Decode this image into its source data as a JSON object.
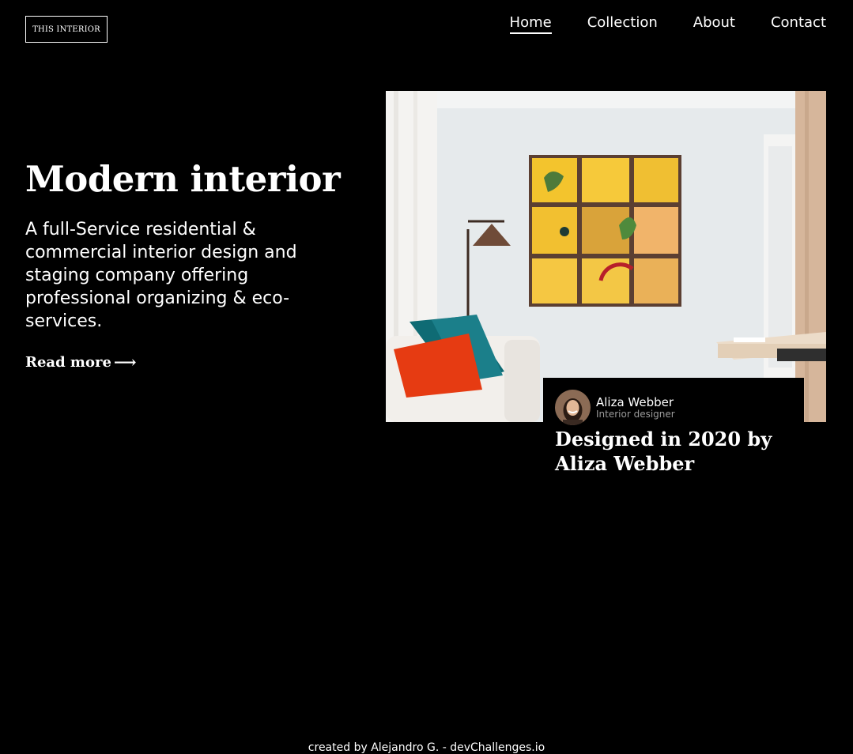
{
  "logo": {
    "text": "THIS INTERIOR"
  },
  "nav": {
    "items": [
      {
        "label": "Home",
        "active": true
      },
      {
        "label": "Collection",
        "active": false
      },
      {
        "label": "About",
        "active": false
      },
      {
        "label": "Contact",
        "active": false
      }
    ]
  },
  "hero": {
    "title": "Modern interior",
    "description": "A full-Service residential & commercial interior design and staging company offering professional organizing & eco-services.",
    "read_more": "Read more",
    "read_more_icon": "arrow-right-icon"
  },
  "card": {
    "author_name": "Aliza Webber",
    "author_role": "Interior designer",
    "title": "Designed in 2020 by Aliza Webber"
  },
  "footer": {
    "credit": "created by Alejandro G. - devChallenges.io"
  }
}
